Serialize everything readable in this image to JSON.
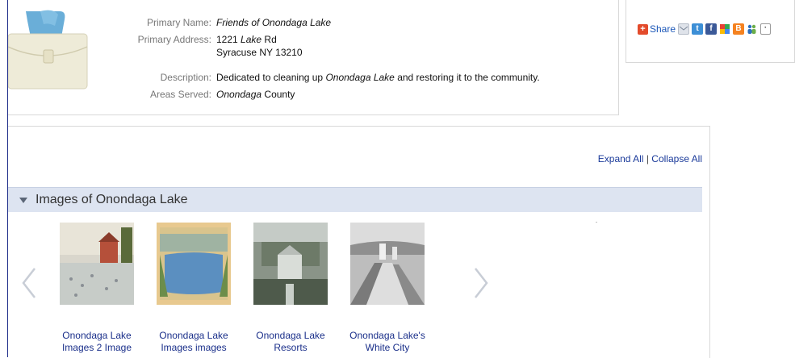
{
  "org": {
    "labels": {
      "name": "Primary Name:",
      "address": "Primary Address:",
      "description": "Description:",
      "areas": "Areas Served:"
    },
    "name": "Friends of Onondaga Lake",
    "address_line1_num": "1221",
    "address_line1_street_em": "Lake",
    "address_line1_suffix": "Rd",
    "address_line2": "Syracuse NY 13210",
    "description_pre": "Dedicated to cleaning up",
    "description_em": "Onondaga Lake",
    "description_post": "and restoring it to the community.",
    "areas_em": "Onondaga",
    "areas_post": "County"
  },
  "share": {
    "label": "Share",
    "icons": [
      "email-icon",
      "twitter-icon",
      "facebook-icon",
      "google-icon",
      "blogger-icon",
      "myspace-icon",
      "more-icon"
    ]
  },
  "main": {
    "expand_all": "Expand All",
    "separator": "|",
    "collapse_all": "Collapse All",
    "section_title": "Images of Onondaga Lake",
    "images": [
      {
        "caption_line1": "Onondaga Lake",
        "caption_line2": "Images 2 Image"
      },
      {
        "caption_line1": "Onondaga Lake",
        "caption_line2": "Images images"
      },
      {
        "caption_line1": "Onondaga Lake",
        "caption_line2": "Resorts"
      },
      {
        "caption_line1": "Onondaga Lake's",
        "caption_line2": "White City"
      }
    ]
  },
  "colors": {
    "link": "#1a2f8a",
    "section_bg": "#dde4f1",
    "share_red": "#e34b2b"
  }
}
